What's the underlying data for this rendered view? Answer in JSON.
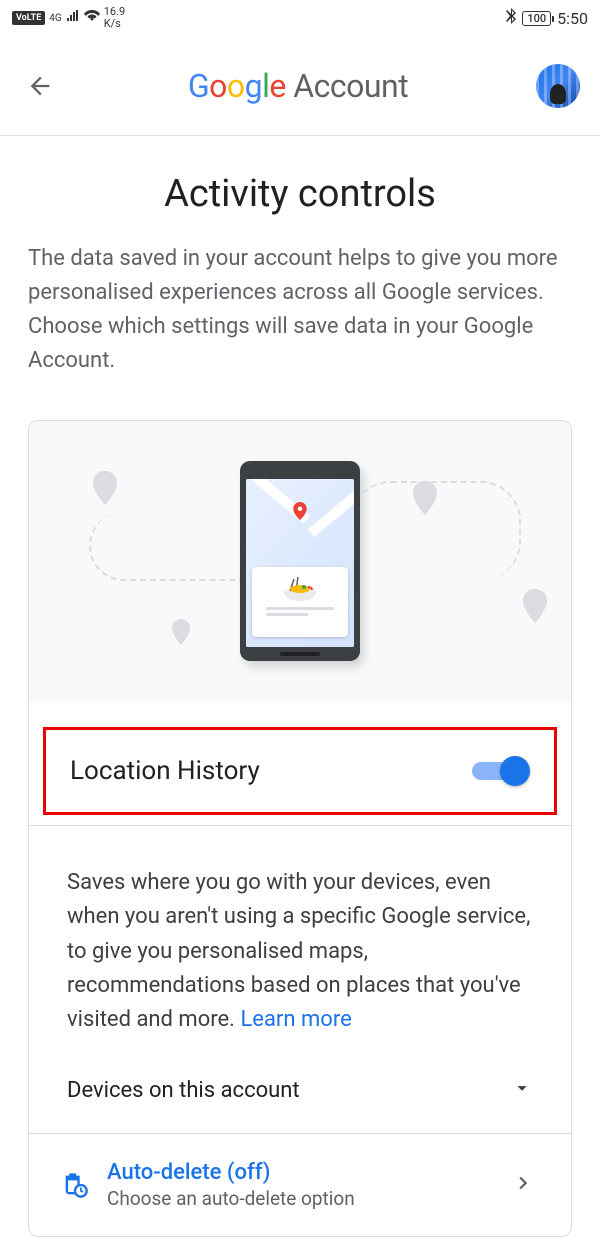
{
  "status": {
    "volte": "VoLTE",
    "network": "4G",
    "speed_value": "16.9",
    "speed_unit": "K/s",
    "battery": "100",
    "time": "5:50"
  },
  "header": {
    "brand_google": "Google",
    "brand_account": " Account"
  },
  "page": {
    "title": "Activity controls",
    "description": "The data saved in your account helps to give you more personalised experiences across all Google services. Choose which settings will save data in your Google Account."
  },
  "location_history": {
    "label": "Location History",
    "toggle_on": true,
    "description": "Saves where you go with your devices, even when you aren't using a specific Google service, to give you personalised maps, recommendations based on places that you've visited and more. ",
    "learn_more": "Learn more",
    "devices_label": "Devices on this account"
  },
  "auto_delete": {
    "title": "Auto-delete (off)",
    "subtitle": "Choose an auto-delete option"
  }
}
